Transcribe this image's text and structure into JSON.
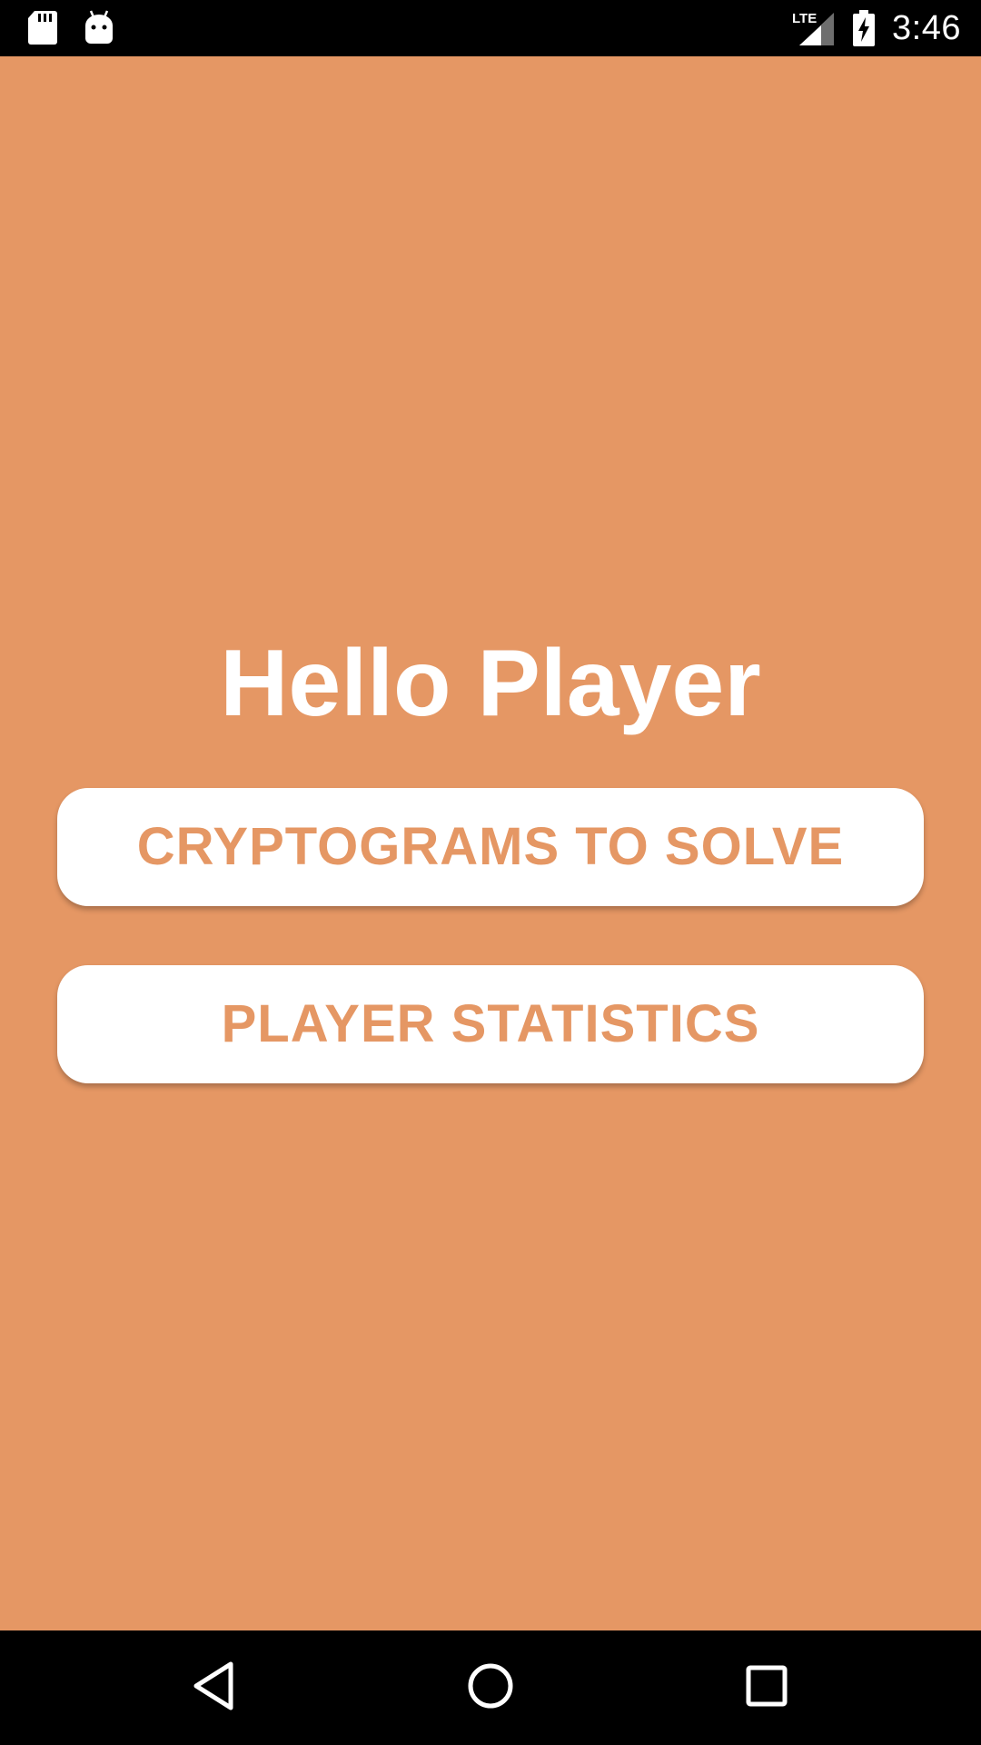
{
  "status_bar": {
    "time": "3:46",
    "network_label": "LTE",
    "icons": [
      "sd-card-icon",
      "android-debug-icon",
      "lte-signal-icon",
      "battery-charging-icon"
    ]
  },
  "main": {
    "background_color": "#E59764",
    "title": "Hello Player",
    "buttons": [
      {
        "label": "CRYPTOGRAMS TO SOLVE"
      },
      {
        "label": "PLAYER STATISTICS"
      }
    ]
  },
  "nav_bar": {
    "icons": [
      "back-icon",
      "home-icon",
      "recents-icon"
    ]
  }
}
